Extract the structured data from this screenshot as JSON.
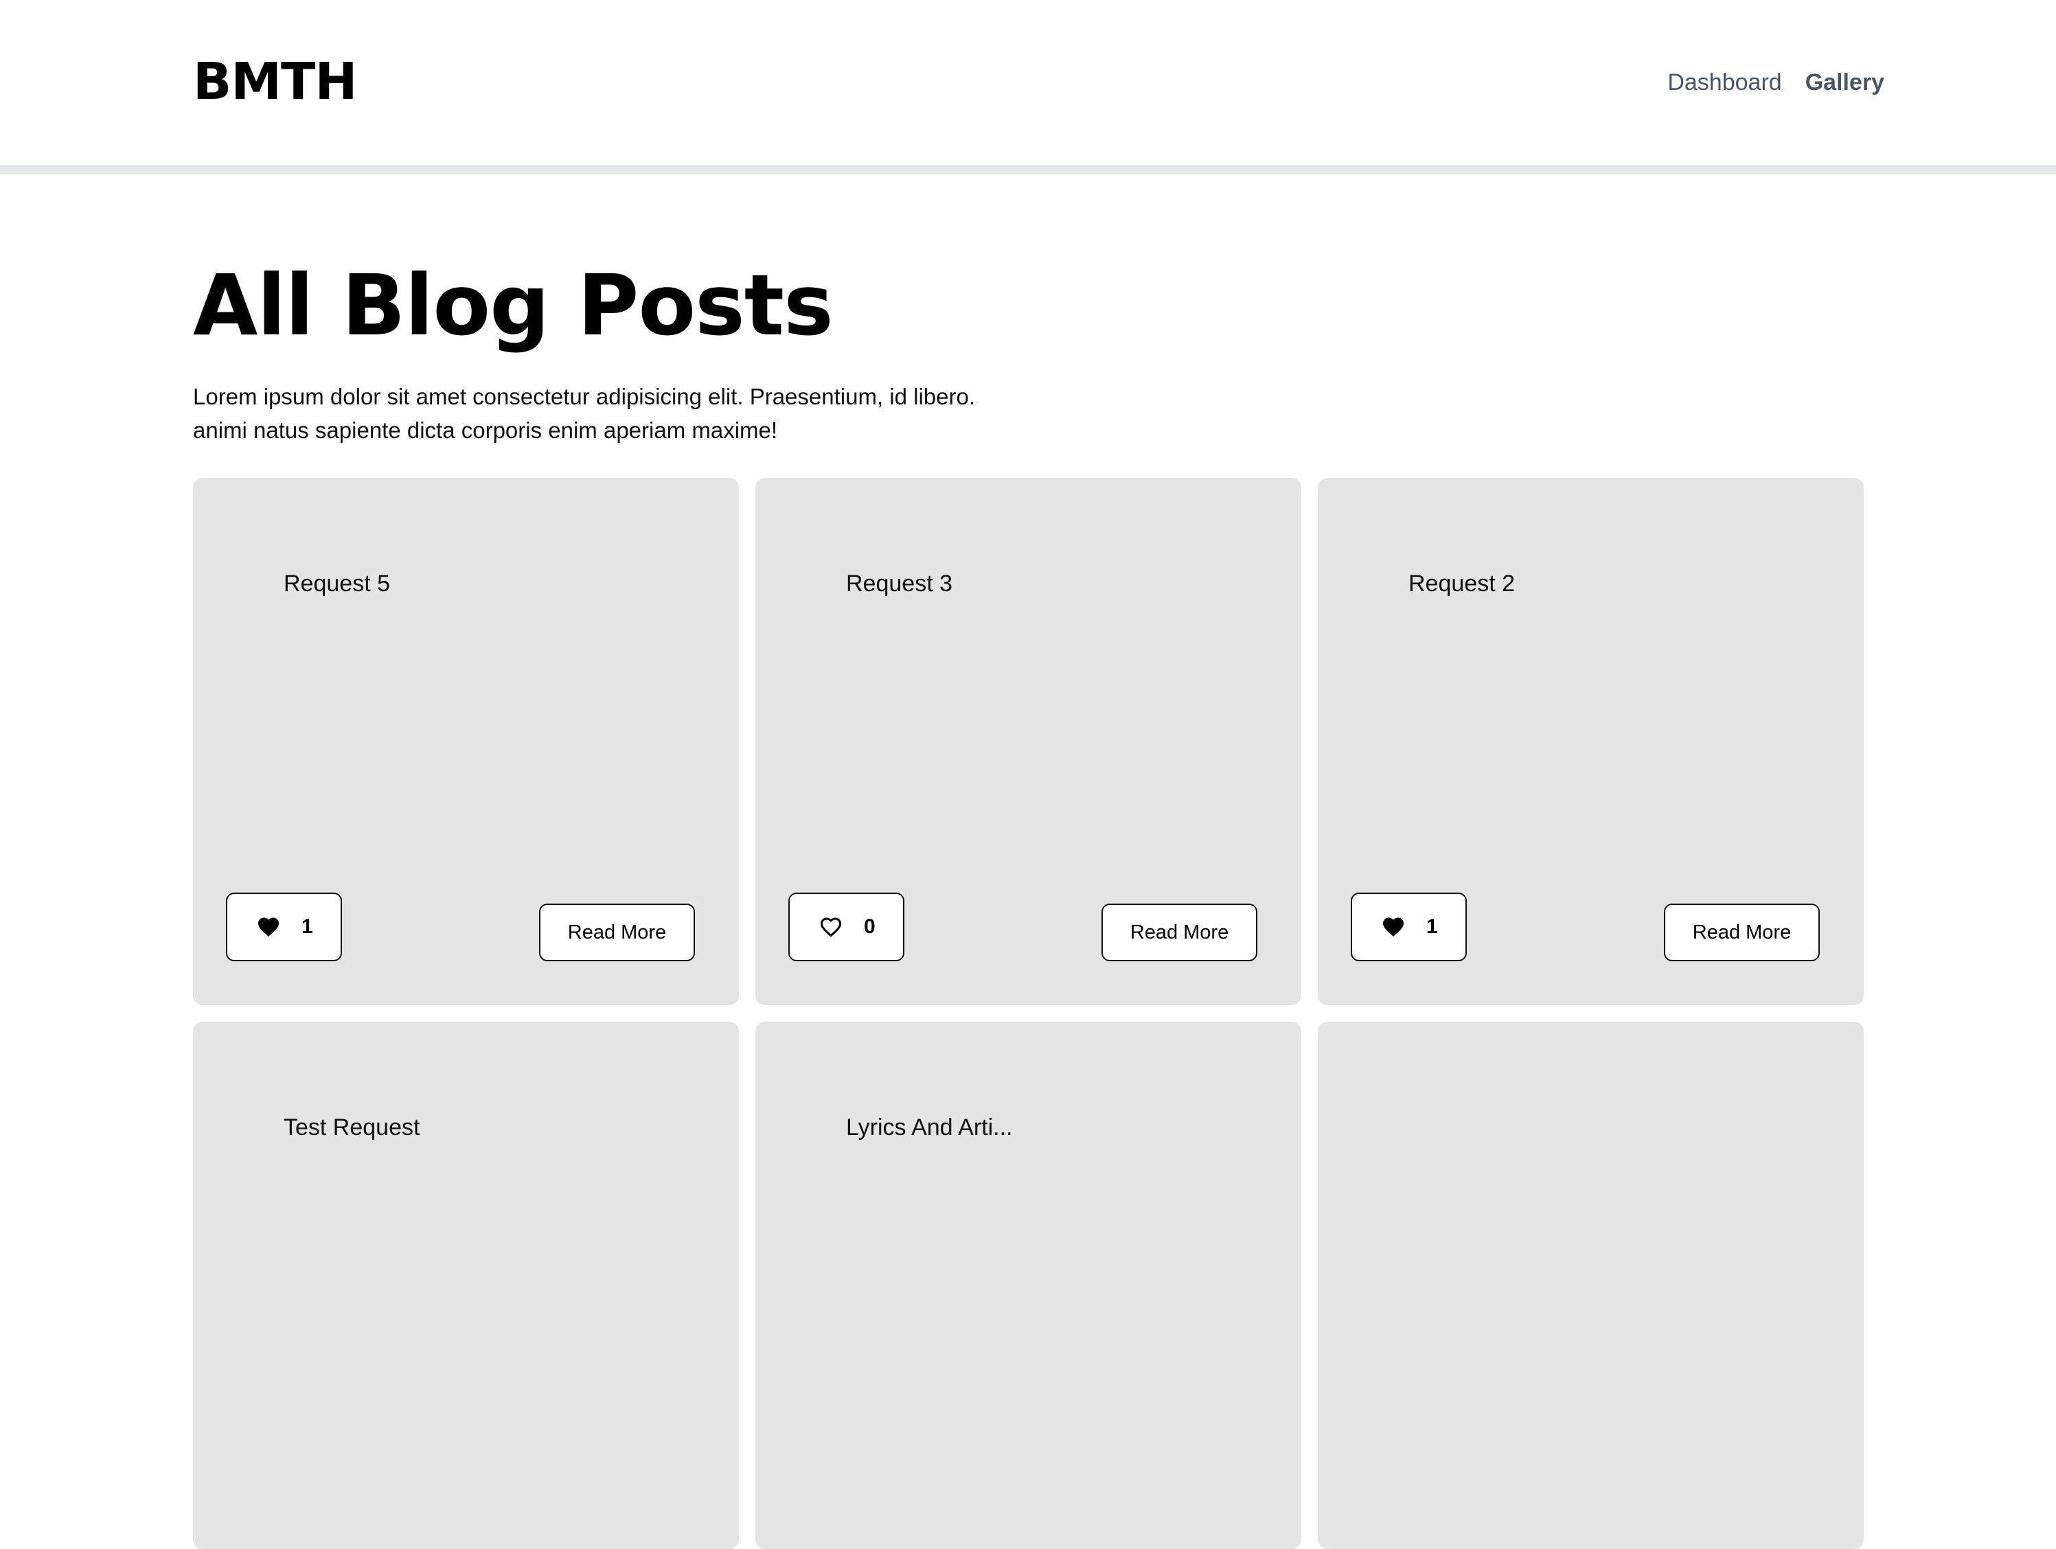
{
  "brand": "BMTH",
  "nav": {
    "items": [
      {
        "label": "Dashboard",
        "active": false
      },
      {
        "label": "Gallery",
        "active": true
      }
    ]
  },
  "page": {
    "title": "All Blog Posts",
    "description": "Lorem ipsum dolor sit amet consectetur adipisicing elit. Praesentium, id libero. animi natus sapiente dicta corporis enim aperiam maxime!"
  },
  "posts": [
    {
      "title": "Request 5",
      "likes": "1",
      "liked": true,
      "read_more_label": "Read More"
    },
    {
      "title": "Request 3",
      "likes": "0",
      "liked": false,
      "read_more_label": "Read More"
    },
    {
      "title": "Request 2",
      "likes": "1",
      "liked": true,
      "read_more_label": "Read More"
    },
    {
      "title": "Test Request"
    },
    {
      "title": "Lyrics And Arti..."
    },
    {
      "title": ""
    }
  ],
  "icons": {
    "heart_filled": "heart-filled-icon",
    "heart_outline": "heart-outline-icon"
  },
  "colors": {
    "card_background": "#e5e5e5",
    "nav_text": "#4b5563",
    "divider": "#e5e7eb"
  }
}
